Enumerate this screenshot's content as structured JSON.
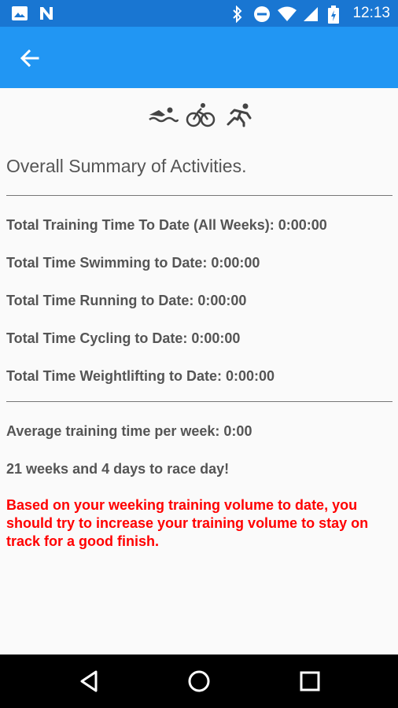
{
  "status_bar": {
    "time": "12:13",
    "left_icons": [
      "image-icon",
      "n-icon"
    ],
    "right_icons": [
      "bluetooth-icon",
      "do-not-disturb-icon",
      "wifi-icon",
      "signal-icon",
      "battery-icon"
    ]
  },
  "app_bar": {
    "back_icon": "arrow-left-icon",
    "color": "#2196f3"
  },
  "header_icons": [
    "swim-icon",
    "bike-icon",
    "run-icon"
  ],
  "summary": {
    "title": "Overall Summary of Activities.",
    "total_training": "Total Training Time To Date (All Weeks): 0:00:00",
    "swimming": "Total Time Swimming to Date: 0:00:00",
    "running": "Total Time Running to Date: 0:00:00",
    "cycling": "Total Time Cycling to Date: 0:00:00",
    "weightlifting": "Total Time Weightlifting to Date: 0:00:00",
    "average_per_week": "Average training time per week: 0:00",
    "countdown": "21 weeks and 4 days to race day!",
    "warning": "Based on your weeking training volume to date, you should try to increase your training volume to stay on track for a good finish.",
    "warning_color": "#ff0000"
  },
  "nav_bar": {
    "buttons": [
      "back-triangle-icon",
      "home-circle-icon",
      "recents-square-icon"
    ]
  }
}
